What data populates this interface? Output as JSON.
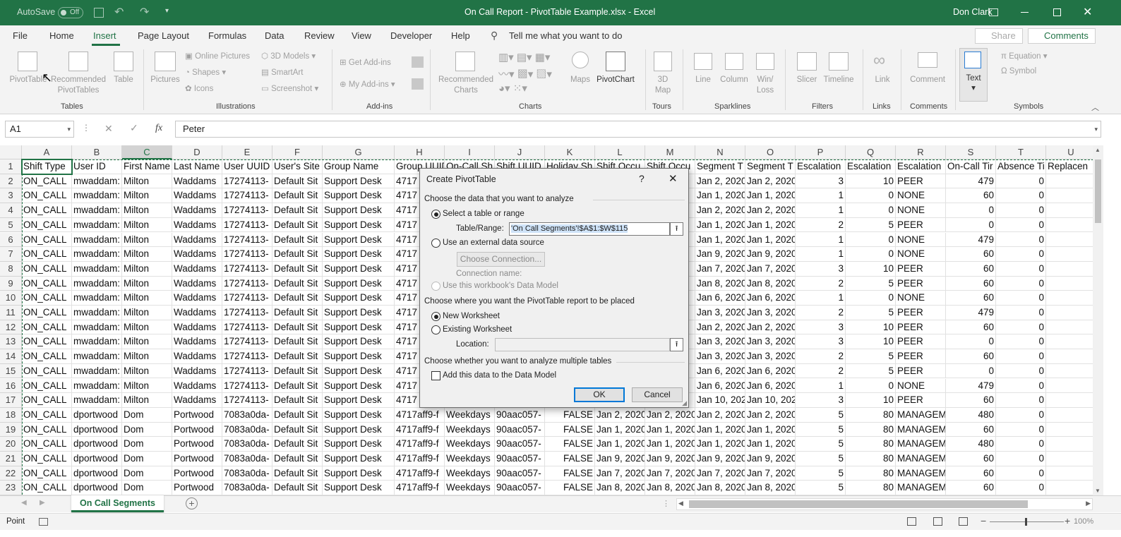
{
  "app": {
    "autosave": "AutoSave",
    "autosave_state": "Off",
    "title": "On Call Report - PivotTable Example.xlsx  -  Excel",
    "user": "Don Clark"
  },
  "menu": {
    "tabs": [
      "File",
      "Home",
      "Insert",
      "Page Layout",
      "Formulas",
      "Data",
      "Review",
      "View",
      "Developer",
      "Help"
    ],
    "tell": "Tell me what you want to do",
    "share": "Share",
    "comments": "Comments"
  },
  "ribbon": {
    "pivottable": "PivotTable",
    "recommended_pivot": [
      "Recommended",
      "PivotTables"
    ],
    "table": "Table",
    "grp_tables": "Tables",
    "pictures": "Pictures",
    "online_pictures": "Online Pictures",
    "shapes": "Shapes",
    "icons": "Icons",
    "models_3d": "3D Models",
    "smartart": "SmartArt",
    "screenshot": "Screenshot",
    "grp_illustrations": "Illustrations",
    "get_addins": "Get Add-ins",
    "my_addins": "My Add-ins",
    "grp_addins": "Add-ins",
    "rec_charts": [
      "Recommended",
      "Charts"
    ],
    "maps": "Maps",
    "pivotchart": "PivotChart",
    "grp_charts": "Charts",
    "map3d": [
      "3D",
      "Map"
    ],
    "grp_tours": "Tours",
    "line": "Line",
    "column": "Column",
    "winloss": [
      "Win/",
      "Loss"
    ],
    "grp_sparklines": "Sparklines",
    "slicer": "Slicer",
    "timeline": "Timeline",
    "grp_filters": "Filters",
    "link": "Link",
    "grp_links": "Links",
    "comment": "Comment",
    "grp_comments": "Comments",
    "text": "Text",
    "equation": "Equation",
    "symbol": "Symbol",
    "grp_symbols": "Symbols"
  },
  "formula": {
    "namebox": "A1",
    "fx": "fx",
    "value": "Peter"
  },
  "columns": [
    {
      "l": "A",
      "w": 71
    },
    {
      "l": "B",
      "w": 71
    },
    {
      "l": "C",
      "w": 71
    },
    {
      "l": "D",
      "w": 71
    },
    {
      "l": "E",
      "w": 71
    },
    {
      "l": "F",
      "w": 71
    },
    {
      "l": "G",
      "w": 102
    },
    {
      "l": "H",
      "w": 71
    },
    {
      "l": "I",
      "w": 71
    },
    {
      "l": "J",
      "w": 71
    },
    {
      "l": "K",
      "w": 71
    },
    {
      "l": "L",
      "w": 71
    },
    {
      "l": "M",
      "w": 71
    },
    {
      "l": "N",
      "w": 71
    },
    {
      "l": "O",
      "w": 71
    },
    {
      "l": "P",
      "w": 71
    },
    {
      "l": "Q",
      "w": 71
    },
    {
      "l": "R",
      "w": 71
    },
    {
      "l": "S",
      "w": 71
    },
    {
      "l": "T",
      "w": 71
    },
    {
      "l": "U",
      "w": 71
    }
  ],
  "numeric_cols": [
    10,
    15,
    16,
    18,
    19
  ],
  "rows": [
    [
      "Shift Type",
      "User ID",
      "First Name",
      "Last Name",
      "User UUID",
      "User's Site",
      "Group Name",
      "Group UUID",
      "On-Call Sh",
      "Shift UUID",
      "Holiday Sh",
      "Shift Occu",
      "Shift Occu",
      "Segment T",
      "Segment T",
      "Escalation",
      "Escalation",
      "Escalation",
      "On-Call Tir",
      "Absence Ti",
      "Replacen"
    ],
    [
      "ON_CALL",
      "mwaddam:",
      "Milton",
      "Waddams",
      "17274113-",
      "Default Sit",
      "Support Desk",
      "4717",
      "",
      "",
      "",
      "",
      "",
      "Jan 2, 2020",
      "Jan 2, 2020",
      "3",
      "10",
      "PEER",
      "479",
      "0",
      ""
    ],
    [
      "ON_CALL",
      "mwaddam:",
      "Milton",
      "Waddams",
      "17274113-",
      "Default Sit",
      "Support Desk",
      "4717",
      "",
      "",
      "",
      "",
      "",
      "Jan 1, 2020",
      "Jan 1, 2020",
      "1",
      "0",
      "NONE",
      "60",
      "0",
      ""
    ],
    [
      "ON_CALL",
      "mwaddam:",
      "Milton",
      "Waddams",
      "17274113-",
      "Default Sit",
      "Support Desk",
      "4717",
      "",
      "",
      "",
      "",
      "",
      "Jan 2, 2020",
      "Jan 2, 2020",
      "1",
      "0",
      "NONE",
      "0",
      "0",
      ""
    ],
    [
      "ON_CALL",
      "mwaddam:",
      "Milton",
      "Waddams",
      "17274113-",
      "Default Sit",
      "Support Desk",
      "4717",
      "",
      "",
      "",
      "",
      "",
      "Jan 1, 2020",
      "Jan 1, 2020",
      "2",
      "5",
      "PEER",
      "0",
      "0",
      ""
    ],
    [
      "ON_CALL",
      "mwaddam:",
      "Milton",
      "Waddams",
      "17274113-",
      "Default Sit",
      "Support Desk",
      "4717",
      "",
      "",
      "",
      "",
      "",
      "Jan 1, 2020",
      "Jan 1, 2020",
      "1",
      "0",
      "NONE",
      "479",
      "0",
      ""
    ],
    [
      "ON_CALL",
      "mwaddam:",
      "Milton",
      "Waddams",
      "17274113-",
      "Default Sit",
      "Support Desk",
      "4717",
      "",
      "",
      "",
      "",
      "",
      "Jan 9, 2020",
      "Jan 9, 2020",
      "1",
      "0",
      "NONE",
      "60",
      "0",
      ""
    ],
    [
      "ON_CALL",
      "mwaddam:",
      "Milton",
      "Waddams",
      "17274113-",
      "Default Sit",
      "Support Desk",
      "4717",
      "",
      "",
      "",
      "",
      "",
      "Jan 7, 2020",
      "Jan 7, 2020",
      "3",
      "10",
      "PEER",
      "60",
      "0",
      ""
    ],
    [
      "ON_CALL",
      "mwaddam:",
      "Milton",
      "Waddams",
      "17274113-",
      "Default Sit",
      "Support Desk",
      "4717",
      "",
      "",
      "",
      "",
      "",
      "Jan 8, 2020",
      "Jan 8, 2020",
      "2",
      "5",
      "PEER",
      "60",
      "0",
      ""
    ],
    [
      "ON_CALL",
      "mwaddam:",
      "Milton",
      "Waddams",
      "17274113-",
      "Default Sit",
      "Support Desk",
      "4717",
      "",
      "",
      "",
      "",
      "",
      "Jan 6, 2020",
      "Jan 6, 2020",
      "1",
      "0",
      "NONE",
      "60",
      "0",
      ""
    ],
    [
      "ON_CALL",
      "mwaddam:",
      "Milton",
      "Waddams",
      "17274113-",
      "Default Sit",
      "Support Desk",
      "4717",
      "",
      "",
      "",
      "",
      "",
      "Jan 3, 2020",
      "Jan 3, 2020",
      "2",
      "5",
      "PEER",
      "479",
      "0",
      ""
    ],
    [
      "ON_CALL",
      "mwaddam:",
      "Milton",
      "Waddams",
      "17274113-",
      "Default Sit",
      "Support Desk",
      "4717",
      "",
      "",
      "",
      "",
      "",
      "Jan 2, 2020",
      "Jan 2, 2020",
      "3",
      "10",
      "PEER",
      "60",
      "0",
      ""
    ],
    [
      "ON_CALL",
      "mwaddam:",
      "Milton",
      "Waddams",
      "17274113-",
      "Default Sit",
      "Support Desk",
      "4717",
      "",
      "",
      "",
      "",
      "",
      "Jan 3, 2020",
      "Jan 3, 2020",
      "3",
      "10",
      "PEER",
      "0",
      "0",
      ""
    ],
    [
      "ON_CALL",
      "mwaddam:",
      "Milton",
      "Waddams",
      "17274113-",
      "Default Sit",
      "Support Desk",
      "4717",
      "",
      "",
      "",
      "",
      "",
      "Jan 3, 2020",
      "Jan 3, 2020",
      "2",
      "5",
      "PEER",
      "60",
      "0",
      ""
    ],
    [
      "ON_CALL",
      "mwaddam:",
      "Milton",
      "Waddams",
      "17274113-",
      "Default Sit",
      "Support Desk",
      "4717",
      "",
      "",
      "",
      "",
      "",
      "Jan 6, 2020",
      "Jan 6, 2020",
      "2",
      "5",
      "PEER",
      "0",
      "0",
      ""
    ],
    [
      "ON_CALL",
      "mwaddam:",
      "Milton",
      "Waddams",
      "17274113-",
      "Default Sit",
      "Support Desk",
      "4717",
      "",
      "",
      "",
      "",
      "",
      "Jan 6, 2020",
      "Jan 6, 2020",
      "1",
      "0",
      "NONE",
      "479",
      "0",
      ""
    ],
    [
      "ON_CALL",
      "mwaddam:",
      "Milton",
      "Waddams",
      "17274113-",
      "Default Sit",
      "Support Desk",
      "4717",
      "",
      "",
      "",
      "",
      "",
      "Jan 10, 2020",
      "Jan 10, 2020",
      "3",
      "10",
      "PEER",
      "60",
      "0",
      ""
    ],
    [
      "ON_CALL",
      "dportwood",
      "Dom",
      "Portwood",
      "7083a0da-",
      "Default Sit",
      "Support Desk",
      "4717aff9-f",
      "Weekdays",
      "90aac057-",
      "FALSE",
      "Jan 2, 2020",
      "Jan 2, 2020",
      "Jan 2, 2020",
      "Jan 2, 2020",
      "5",
      "80",
      "MANAGEM",
      "480",
      "0",
      ""
    ],
    [
      "ON_CALL",
      "dportwood",
      "Dom",
      "Portwood",
      "7083a0da-",
      "Default Sit",
      "Support Desk",
      "4717aff9-f",
      "Weekdays",
      "90aac057-",
      "FALSE",
      "Jan 1, 2020",
      "Jan 1, 2020",
      "Jan 1, 2020",
      "Jan 1, 2020",
      "5",
      "80",
      "MANAGEM",
      "60",
      "0",
      ""
    ],
    [
      "ON_CALL",
      "dportwood",
      "Dom",
      "Portwood",
      "7083a0da-",
      "Default Sit",
      "Support Desk",
      "4717aff9-f",
      "Weekdays",
      "90aac057-",
      "FALSE",
      "Jan 1, 2020",
      "Jan 1, 2020",
      "Jan 1, 2020",
      "Jan 1, 2020",
      "5",
      "80",
      "MANAGEM",
      "480",
      "0",
      ""
    ],
    [
      "ON_CALL",
      "dportwood",
      "Dom",
      "Portwood",
      "7083a0da-",
      "Default Sit",
      "Support Desk",
      "4717aff9-f",
      "Weekdays",
      "90aac057-",
      "FALSE",
      "Jan 9, 2020",
      "Jan 9, 2020",
      "Jan 9, 2020",
      "Jan 9, 2020",
      "5",
      "80",
      "MANAGEM",
      "60",
      "0",
      ""
    ],
    [
      "ON_CALL",
      "dportwood",
      "Dom",
      "Portwood",
      "7083a0da-",
      "Default Sit",
      "Support Desk",
      "4717aff9-f",
      "Weekdays",
      "90aac057-",
      "FALSE",
      "Jan 7, 2020",
      "Jan 7, 2020",
      "Jan 7, 2020",
      "Jan 7, 2020",
      "5",
      "80",
      "MANAGEM",
      "60",
      "0",
      ""
    ],
    [
      "ON_CALL",
      "dportwood",
      "Dom",
      "Portwood",
      "7083a0da-",
      "Default Sit",
      "Support Desk",
      "4717aff9-f",
      "Weekdays",
      "90aac057-",
      "FALSE",
      "Jan 8, 2020",
      "Jan 8, 2020",
      "Jan 8, 2020",
      "Jan 8, 2020",
      "5",
      "80",
      "MANAGEM",
      "60",
      "0",
      ""
    ]
  ],
  "dialog": {
    "title": "Create PivotTable",
    "help": "?",
    "close": "✕",
    "sec1": "Choose the data that you want to analyze",
    "opt_table": "Select a table or range",
    "range_label": "Table/Range:",
    "range_value": "'On Call Segments'!$A$1:$W$115",
    "opt_external": "Use an external data source",
    "choose_conn": "Choose Connection...",
    "conn_name": "Connection name:",
    "opt_model": "Use this workbook's Data Model",
    "sec2": "Choose where you want the PivotTable report to be placed",
    "opt_new": "New Worksheet",
    "opt_existing": "Existing Worksheet",
    "location_label": "Location:",
    "location_value": "",
    "sec3": "Choose whether you want to analyze multiple tables",
    "add_model": "Add this data to the Data Model",
    "ok": "OK",
    "cancel": "Cancel"
  },
  "sheet_tab": "On Call Segments",
  "status": {
    "mode": "Point",
    "zoom": "100%"
  },
  "colors": {
    "accent": "#217346",
    "dialog_bg": "#f0f0f0"
  }
}
